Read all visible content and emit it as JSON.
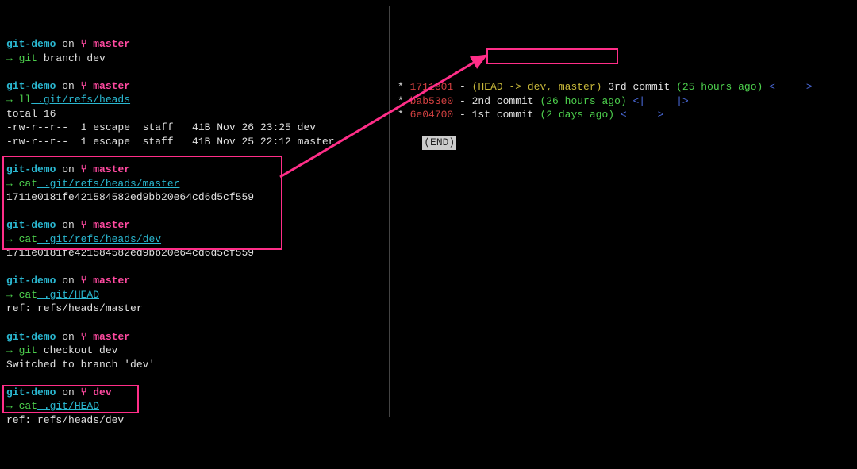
{
  "left": {
    "prompts": [
      {
        "dir": "git-demo",
        "on": "on",
        "branch": "master",
        "cmd": "git",
        "args": "branch dev",
        "args_underline": false,
        "output": []
      },
      {
        "dir": "git-demo",
        "on": "on",
        "branch": "master",
        "cmd": "ll",
        "args": ".git/refs/heads",
        "args_underline": true,
        "output": [
          {
            "text": "total 16",
            "plain": true
          },
          {
            "perms": "-rw-r--r--",
            "links": "1",
            "user": "escape",
            "group": "staff",
            "size": "41B",
            "date": "Nov 26 23:25",
            "name": "dev"
          },
          {
            "perms": "-rw-r--r--",
            "links": "1",
            "user": "escape",
            "group": "staff",
            "size": "41B",
            "date": "Nov 25 22:12",
            "name": "master"
          }
        ]
      },
      {
        "dir": "git-demo",
        "on": "on",
        "branch": "master",
        "cmd": "cat",
        "args": ".git/refs/heads/master",
        "args_underline": true,
        "output": [
          {
            "text": "1711e0181fe421584582ed9bb20e64cd6d5cf559",
            "plain": true
          }
        ]
      },
      {
        "dir": "git-demo",
        "on": "on",
        "branch": "master",
        "cmd": "cat",
        "args": ".git/refs/heads/dev",
        "args_underline": true,
        "output": [
          {
            "text": "1711e0181fe421584582ed9bb20e64cd6d5cf559",
            "plain": true
          }
        ]
      },
      {
        "dir": "git-demo",
        "on": "on",
        "branch": "master",
        "cmd": "cat",
        "args": ".git/HEAD",
        "args_underline": true,
        "output": [
          {
            "text": "ref: refs/heads/master",
            "plain": true
          }
        ]
      },
      {
        "dir": "git-demo",
        "on": "on",
        "branch": "master",
        "cmd": "git",
        "args": "checkout dev",
        "args_underline": false,
        "output": [
          {
            "text": "Switched to branch 'dev'",
            "plain": true
          }
        ]
      },
      {
        "dir": "git-demo",
        "on": "on",
        "branch": "dev",
        "cmd": "cat",
        "args": ".git/HEAD",
        "args_underline": true,
        "output": [
          {
            "text": "ref: refs/heads/dev",
            "plain": true
          }
        ]
      }
    ]
  },
  "right": {
    "log": [
      {
        "marker": "*",
        "hash": "1711e01",
        "hash_class": "red",
        "sep1": " - ",
        "refs": "(HEAD -> dev, master)",
        "refs_class": "yellow",
        "msg": " 3rd commit ",
        "age": "(25 hours ago)",
        "author_l": "<",
        "author_r": ">"
      },
      {
        "marker": "*",
        "hash": "bab53e0",
        "hash_class": "red",
        "sep1": " - ",
        "refs": "",
        "refs_class": "",
        "msg": "2nd commit ",
        "age": "(26 hours ago)",
        "author_l": "<|",
        "author_r": "|>"
      },
      {
        "marker": "*",
        "hash": "6e04700",
        "hash_class": "red",
        "sep1": " - ",
        "refs": "",
        "refs_class": "",
        "msg": "1st commit ",
        "age": "(2 days ago)",
        "author_l": "<",
        "author_r": ">"
      }
    ],
    "end": "(END)"
  },
  "icons": {
    "branch": "⑂"
  }
}
